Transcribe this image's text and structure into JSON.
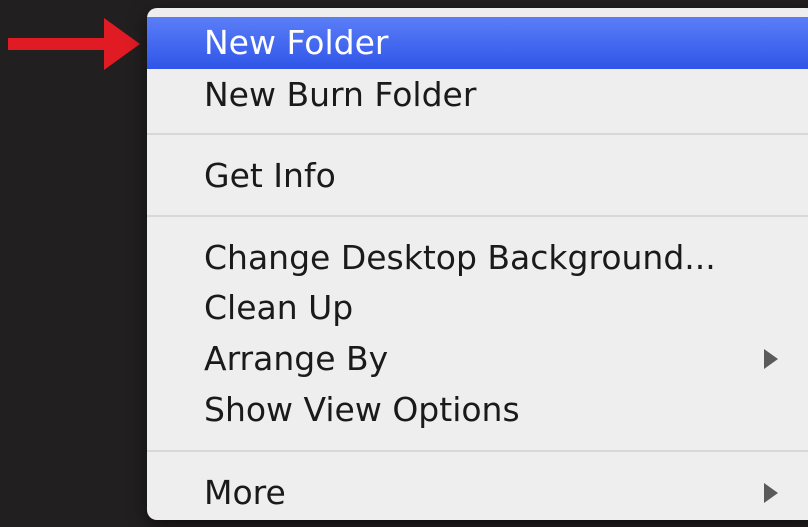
{
  "menu": {
    "items": [
      {
        "label": "New Folder",
        "highlighted": true
      },
      {
        "label": "New Burn Folder"
      },
      {
        "label": "Get Info"
      },
      {
        "label": "Change Desktop Background..."
      },
      {
        "label": "Clean Up"
      },
      {
        "label": "Arrange By",
        "submenu": true
      },
      {
        "label": "Show View Options"
      },
      {
        "label": "More",
        "submenu": true
      }
    ]
  },
  "colors": {
    "highlight": "#3b63f0",
    "menu_background": "#eeeeee",
    "desktop_background": "#221f20",
    "arrow": "#e01b24"
  },
  "icons": {
    "pointer": "red-arrow-right",
    "submenu": "submenu-triangle"
  }
}
